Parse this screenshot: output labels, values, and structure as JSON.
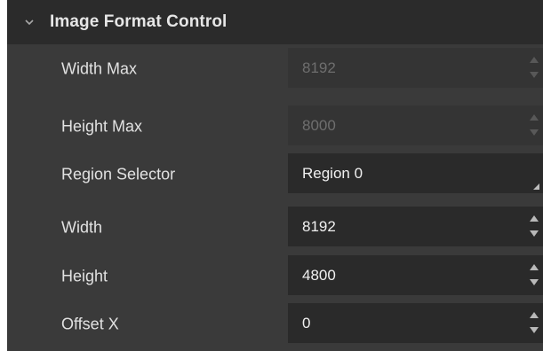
{
  "section": {
    "title": "Image Format Control",
    "expand_icon": "chevron-down-icon"
  },
  "rows": [
    {
      "label": "Width Max",
      "value": "8192",
      "control": "spinbox",
      "enabled": false
    },
    {
      "label": "Height Max",
      "value": "8000",
      "control": "spinbox",
      "enabled": false
    },
    {
      "label": "Region Selector",
      "value": "Region 0",
      "control": "dropdown",
      "enabled": true
    },
    {
      "label": "Width",
      "value": "8192",
      "control": "spinbox",
      "enabled": true
    },
    {
      "label": "Height",
      "value": "4800",
      "control": "spinbox",
      "enabled": true
    },
    {
      "label": "Offset X",
      "value": "0",
      "control": "spinbox",
      "enabled": true
    }
  ],
  "colors": {
    "panel_bg": "#3a3a3a",
    "header_bg": "#2b2b2b",
    "field_bg": "#2a2a2a",
    "field_disabled_bg": "#343434",
    "text": "#e1e1e1",
    "disabled_text": "#6e6e6e"
  }
}
